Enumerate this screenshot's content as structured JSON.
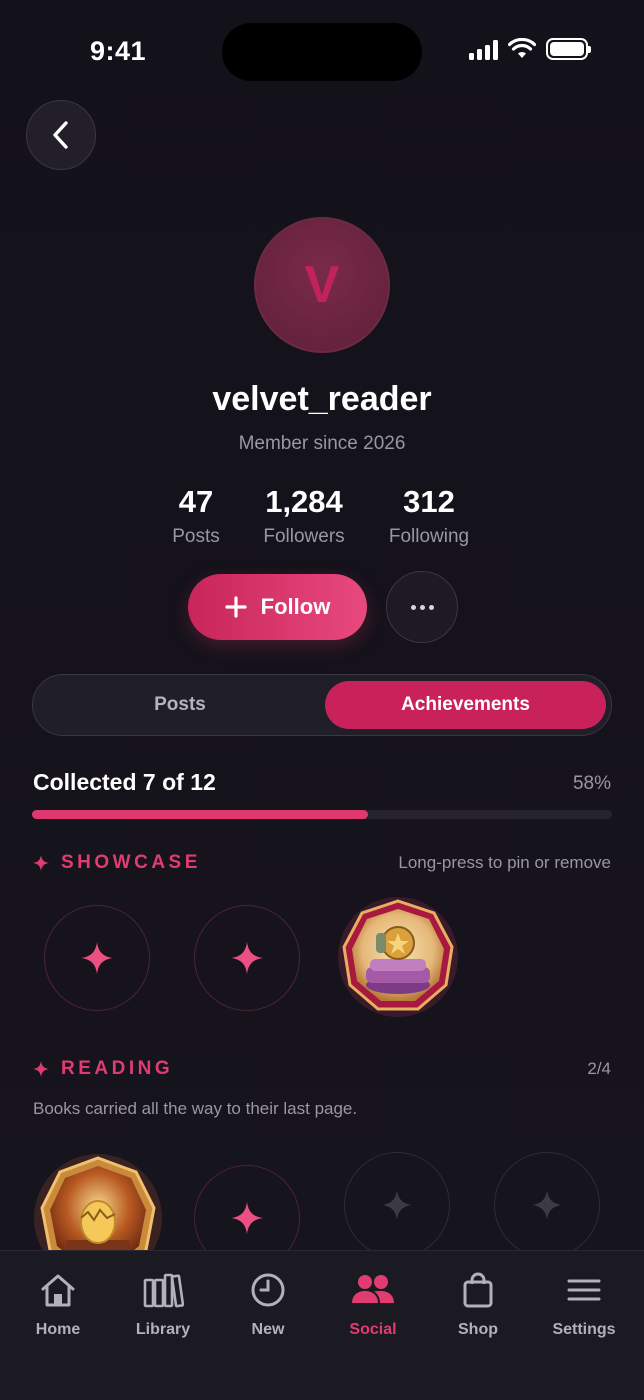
{
  "status_bar": {
    "time": "9:41"
  },
  "profile": {
    "avatar_initial": "V",
    "username": "velvet_reader",
    "member_since": "Member since 2026"
  },
  "stats": [
    {
      "value": "47",
      "label": "Posts"
    },
    {
      "value": "1,284",
      "label": "Followers"
    },
    {
      "value": "312",
      "label": "Following"
    }
  ],
  "actions": {
    "follow_label": "Follow"
  },
  "tabs": {
    "posts": "Posts",
    "achievements": "Achievements",
    "active": "Achievements"
  },
  "progress": {
    "text": "Collected 7 of 12",
    "percent_text": "58%",
    "fraction": 0.58
  },
  "showcase": {
    "title": "SHOWCASE",
    "hint": "Long-press to pin or remove",
    "slots": [
      "empty",
      "empty",
      "badge-cushion-medal"
    ]
  },
  "reading": {
    "title": "READING",
    "count": "2/4",
    "description": "Books carried all the way to their last page.",
    "slots": [
      "badge-golden-egg-book",
      "empty",
      "locked",
      "locked"
    ]
  },
  "nav": {
    "items": [
      {
        "label": "Home",
        "icon": "home-icon"
      },
      {
        "label": "Library",
        "icon": "library-icon"
      },
      {
        "label": "New",
        "icon": "clock-icon"
      },
      {
        "label": "Social",
        "icon": "people-icon"
      },
      {
        "label": "Shop",
        "icon": "bag-icon"
      },
      {
        "label": "Settings",
        "icon": "menu-icon"
      }
    ],
    "active": "Social"
  },
  "colors": {
    "accent": "#e03c70",
    "accent_dark": "#c9225a",
    "background": "#15131c",
    "muted_text": "#9a96a5"
  }
}
